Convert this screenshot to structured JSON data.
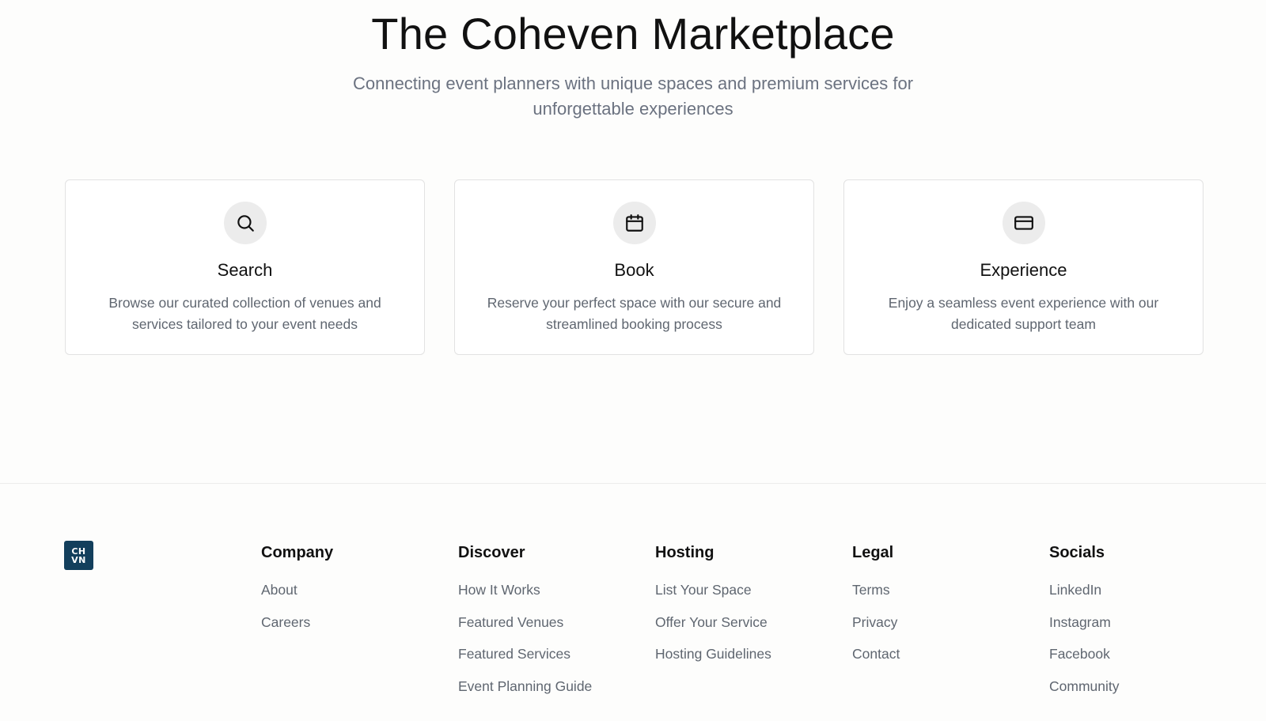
{
  "hero": {
    "title": "The Coheven Marketplace",
    "subtitle": "Connecting event planners with unique spaces and premium services for unforgettable experiences"
  },
  "features": [
    {
      "icon": "search-icon",
      "title": "Search",
      "description": "Browse our curated collection of venues and services tailored to your event needs"
    },
    {
      "icon": "calendar-icon",
      "title": "Book",
      "description": "Reserve your perfect space with our secure and streamlined booking process"
    },
    {
      "icon": "credit-card-icon",
      "title": "Experience",
      "description": "Enjoy a seamless event experience with our dedicated support team"
    }
  ],
  "footer": {
    "logo": {
      "line1": "CH",
      "line2": "VN",
      "color": "#133f5c"
    },
    "columns": [
      {
        "title": "Company",
        "links": [
          "About",
          "Careers"
        ]
      },
      {
        "title": "Discover",
        "links": [
          "How It Works",
          "Featured Venues",
          "Featured Services",
          "Event Planning Guide"
        ]
      },
      {
        "title": "Hosting",
        "links": [
          "List Your Space",
          "Offer Your Service",
          "Hosting Guidelines"
        ]
      },
      {
        "title": "Legal",
        "links": [
          "Terms",
          "Privacy",
          "Contact"
        ]
      },
      {
        "title": "Socials",
        "links": [
          "LinkedIn",
          "Instagram",
          "Facebook",
          "Community"
        ]
      }
    ]
  }
}
